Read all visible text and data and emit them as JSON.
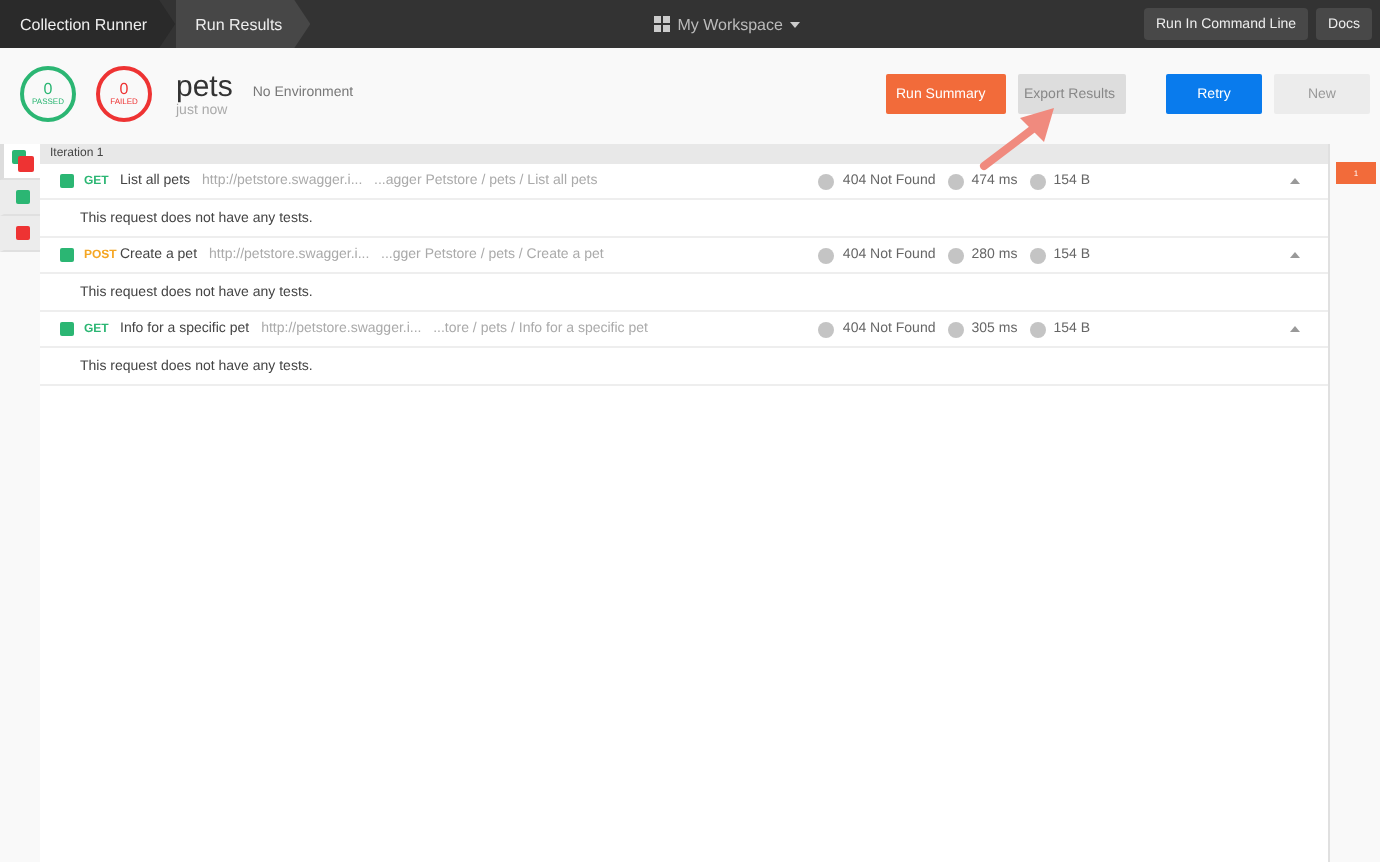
{
  "topbar": {
    "breadcrumbs": [
      {
        "label": "Collection Runner",
        "selected": false
      },
      {
        "label": "Run Results",
        "selected": true
      }
    ],
    "workspace": "My Workspace",
    "buttons": [
      "Run In Command Line",
      "Docs"
    ]
  },
  "summary": {
    "passed": {
      "count": "0",
      "label": "PASSED"
    },
    "failed": {
      "count": "0",
      "label": "FAILED"
    },
    "name": "pets",
    "environment": "No Environment",
    "time": "just now"
  },
  "actions": [
    {
      "label": "Run Summary",
      "kind": "summary"
    },
    {
      "label": "Export Results",
      "kind": "export"
    },
    {
      "label": "Retry",
      "kind": "primary"
    },
    {
      "label": "New",
      "kind": "secondary"
    }
  ],
  "sidebar": [
    {
      "kind": "mixed",
      "selected": true
    },
    {
      "kind": "passed",
      "selected": false
    },
    {
      "kind": "failed",
      "selected": false
    }
  ],
  "iteration": "Iteration 1",
  "requests": [
    {
      "method": "GET",
      "color": "#2bb673",
      "name": "List all pets",
      "url": "http://petstore.swagger.i...",
      "path": "...agger Petstore / pets / List all pets",
      "status": "404 Not Found",
      "time": "474 ms",
      "size": "154 B",
      "message": "This request does not have any tests."
    },
    {
      "method": "POST",
      "color": "#f5a623",
      "name": "Create a pet",
      "url": "http://petstore.swagger.i...",
      "path": "...gger Petstore / pets / Create a pet",
      "status": "404 Not Found",
      "time": "280 ms",
      "size": "154 B",
      "message": "This request does not have any tests."
    },
    {
      "method": "GET",
      "color": "#2bb673",
      "name": "Info for a specific pet",
      "url": "http://petstore.swagger.i...",
      "path": "...tore / pets / Info for a specific pet",
      "status": "404 Not Found",
      "time": "305 ms",
      "size": "154 B",
      "message": "This request does not have any tests."
    }
  ],
  "iteration_tabs": [
    "1"
  ]
}
